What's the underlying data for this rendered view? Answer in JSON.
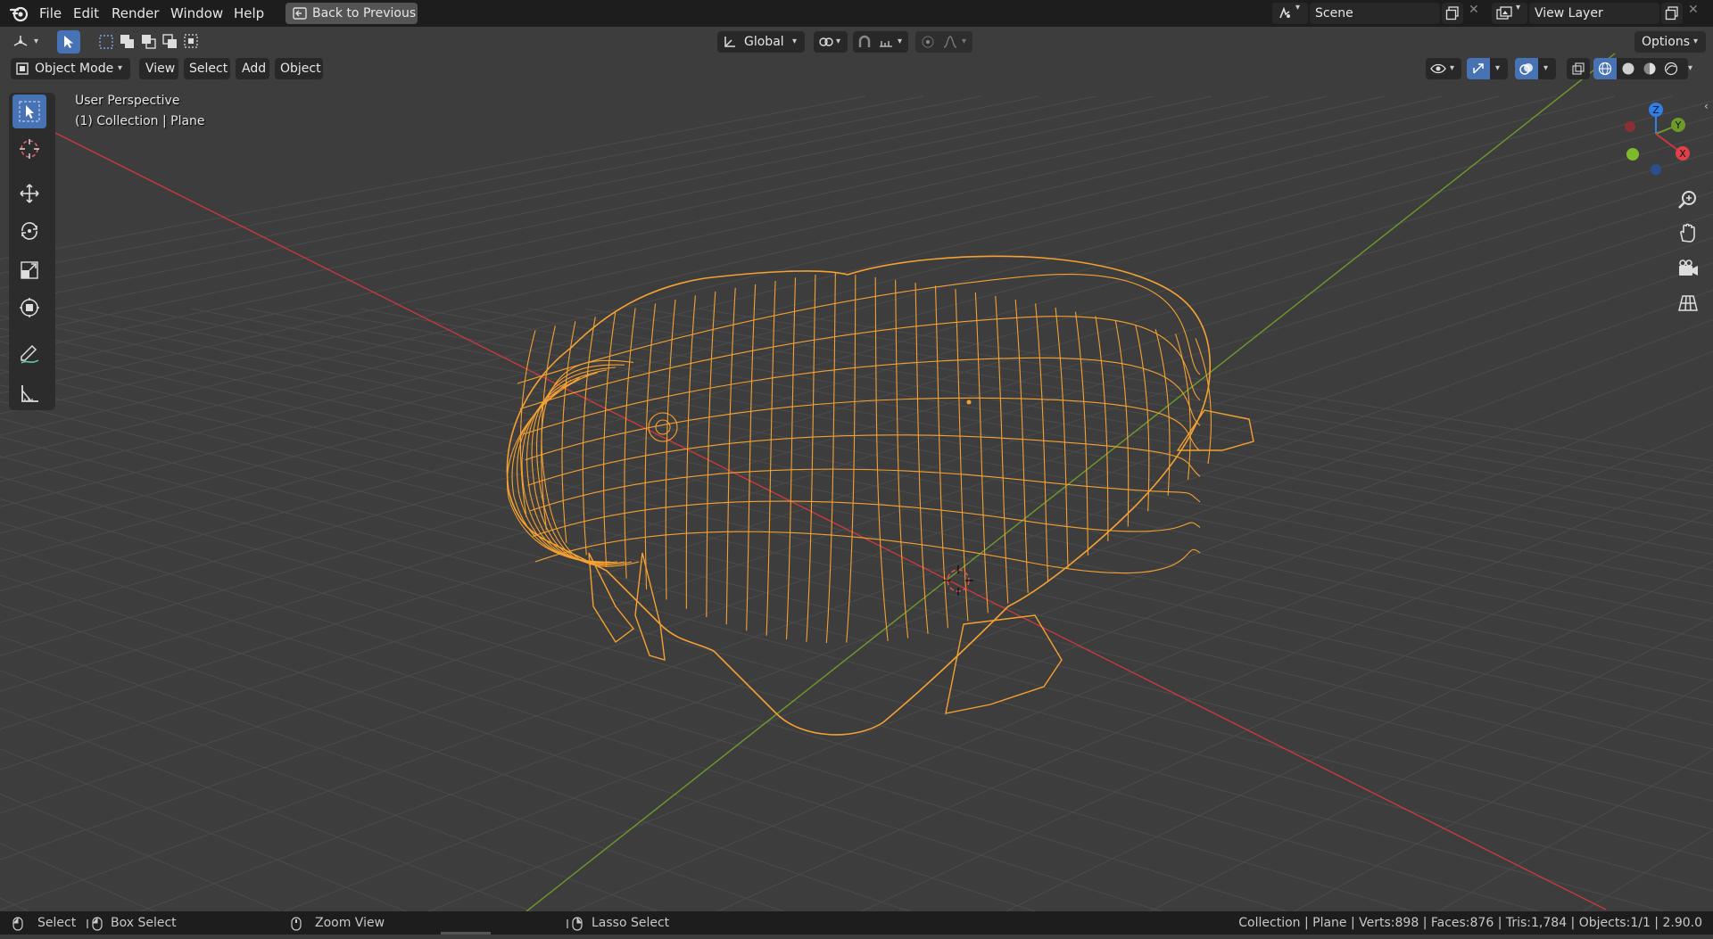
{
  "topbar": {
    "menu": [
      "File",
      "Edit",
      "Render",
      "Window",
      "Help"
    ],
    "back_button": "Back to Previous",
    "scene": "Scene",
    "view_layer": "View Layer"
  },
  "toolheader": {
    "orientation": "Global",
    "options": "Options"
  },
  "viewheader": {
    "mode": "Object Mode",
    "menus": [
      "View",
      "Select",
      "Add",
      "Object"
    ]
  },
  "viewport": {
    "perspective": "User Perspective",
    "collection": "(1) Collection | Plane"
  },
  "gizmo": {
    "x": "X",
    "y": "Y",
    "z": "Z"
  },
  "statusbar": {
    "select": "Select",
    "box_select": "Box Select",
    "zoom_view": "Zoom View",
    "lasso_select": "Lasso Select",
    "stats": "Collection | Plane | Verts:898 | Faces:876 | Tris:1,784 | Objects:1/1 | 2.90.0"
  },
  "colors": {
    "accent": "#4772b3",
    "selection_wire": "#f5a132",
    "x_axis": "#c8393f",
    "y_axis": "#6e9a2c",
    "z_axis": "#2f7fe6"
  }
}
